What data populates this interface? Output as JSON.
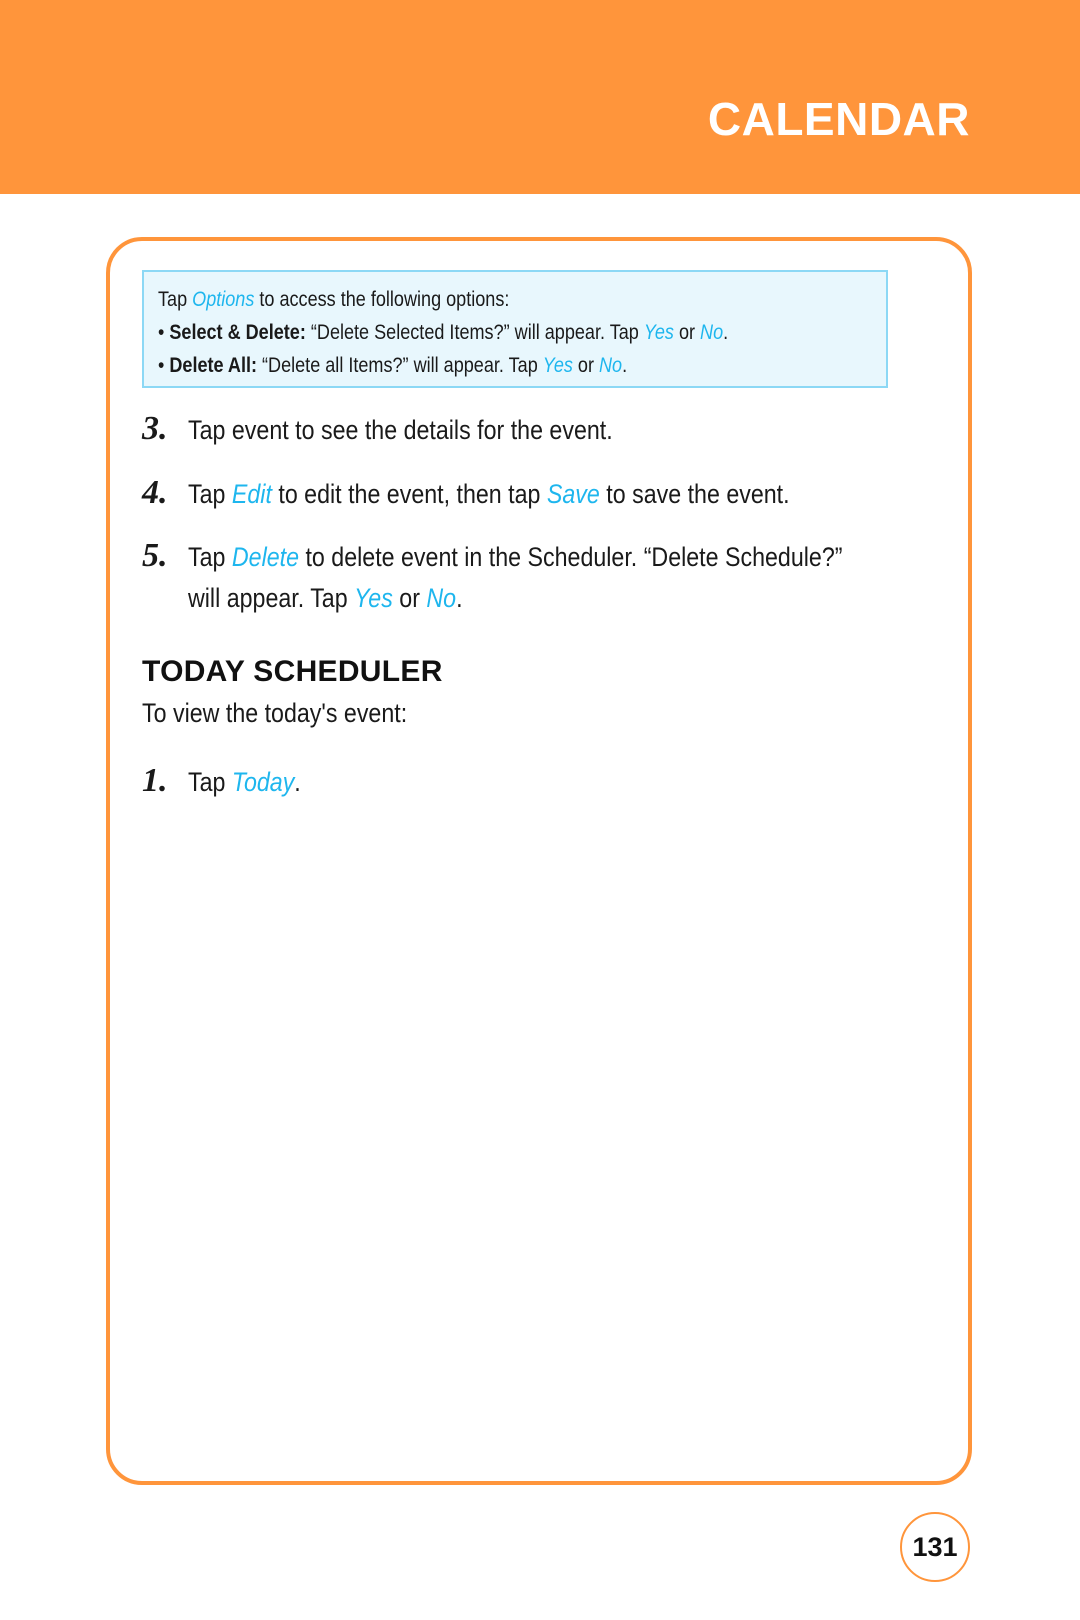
{
  "header": {
    "title": "CALENDAR",
    "color": "#ff953b"
  },
  "note": {
    "intro": {
      "pre": "Tap ",
      "link": "Options",
      "post": " to access the following options:"
    },
    "items": [
      {
        "bullet": "•",
        "label": "Select & Delete:",
        "text": " “Delete Selected Items?” will appear. Tap ",
        "yes": "Yes",
        "or": " or ",
        "no": "No",
        "end": "."
      },
      {
        "bullet": "•",
        "label": "Delete All:",
        "text": " “Delete all Items?” will appear. Tap ",
        "yes": "Yes",
        "or": " or ",
        "no": "No",
        "end": "."
      }
    ]
  },
  "steps": [
    {
      "num": "3.",
      "text": "Tap event to see the details for the event."
    },
    {
      "num": "4.",
      "pre": "Tap ",
      "link1": "Edit",
      "mid": " to edit the event, then tap ",
      "link2": "Save",
      "post": " to save the event."
    },
    {
      "num": "5.",
      "pre": "Tap ",
      "link1": "Delete",
      "mid": " to delete event in the Scheduler. “Delete Schedule?”",
      "cont_pre": "will appear. Tap ",
      "yes": "Yes",
      "or": " or ",
      "no": "No",
      "end": "."
    }
  ],
  "section": {
    "title": "TODAY SCHEDULER",
    "intro": "To view the today's event:",
    "steps": [
      {
        "num": "1.",
        "pre": "Tap ",
        "link": "Today",
        "end": "."
      }
    ]
  },
  "page_number": "131",
  "link_color": "#1eb6ee"
}
